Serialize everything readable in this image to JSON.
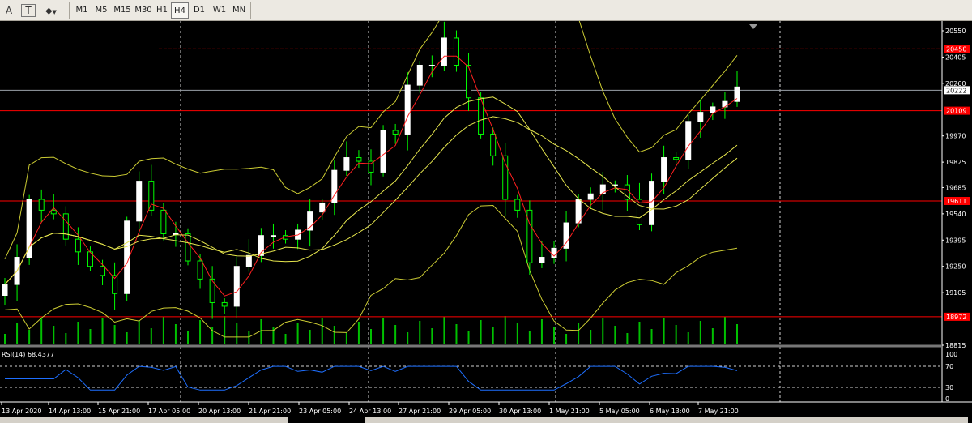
{
  "toolbar": {
    "icons": [
      "text-a-icon",
      "text-box-icon",
      "shapes-dropdown-icon"
    ],
    "icon_glyphs": [
      "A",
      "T",
      "⬥"
    ],
    "timeframes": [
      "M1",
      "M5",
      "M15",
      "M30",
      "H1",
      "H4",
      "D1",
      "W1",
      "MN"
    ],
    "active_timeframe": "H4"
  },
  "colors": {
    "background": "#000000",
    "bull": "#ffffff",
    "bear": "#00ff00",
    "wick": "#00ff00",
    "level": "#ff0000",
    "bands": "#cccc33",
    "ma_fast": "#ff2020",
    "ma_slow": "#e6e64d",
    "rsi": "#1e6fff",
    "volume": "#00c000"
  },
  "price_axis": {
    "labels": [
      "20550",
      "20405",
      "20260",
      "19970",
      "19825",
      "19685",
      "19540",
      "19395",
      "19250",
      "19105",
      "18815"
    ],
    "range": [
      18815,
      20550
    ]
  },
  "price_tags": [
    {
      "label": "20450",
      "value": 20450,
      "bg": "#ff0000",
      "fg": "#ffffff"
    },
    {
      "label": "20222",
      "value": 20222,
      "bg": "#ffffff",
      "fg": "#000000"
    },
    {
      "label": "20109",
      "value": 20109,
      "bg": "#ff0000",
      "fg": "#ffffff"
    },
    {
      "label": "19611",
      "value": 19611,
      "bg": "#ff0000",
      "fg": "#ffffff"
    },
    {
      "label": "18972",
      "value": 18972,
      "bg": "#ff0000",
      "fg": "#ffffff"
    }
  ],
  "levels": [
    20450,
    20109,
    19611,
    18972
  ],
  "current_price": 20222,
  "time_axis": [
    "13 Apr 2020",
    "14 Apr 13:00",
    "15 Apr 21:00",
    "17 Apr 05:00",
    "20 Apr 13:00",
    "21 Apr 21:00",
    "23 Apr 05:00",
    "24 Apr 13:00",
    "27 Apr 21:00",
    "29 Apr 05:00",
    "30 Apr 13:00",
    "1 May 21:00",
    "5 May 05:00",
    "6 May 13:00",
    "7 May 21:00"
  ],
  "rsi": {
    "label": "RSI(14) 68.4377",
    "levels": [
      "100",
      "70",
      "30",
      "0"
    ],
    "value": 68.4377
  },
  "chart_data": {
    "type": "candlestick",
    "symbol_timeframe": "H4",
    "ylim": [
      18815,
      20550
    ],
    "closes": [
      19150,
      19300,
      19620,
      19560,
      19540,
      19400,
      19330,
      19250,
      19200,
      19100,
      19500,
      19720,
      19560,
      19430,
      19430,
      19280,
      19180,
      19050,
      19030,
      19250,
      19310,
      19420,
      19420,
      19400,
      19450,
      19550,
      19600,
      19780,
      19850,
      19830,
      19770,
      20000,
      19980,
      20250,
      20360,
      20360,
      20510,
      20360,
      20180,
      19980,
      19860,
      19620,
      19560,
      19270,
      19300,
      19350,
      19490,
      19620,
      19650,
      19700,
      19700,
      19620,
      19480,
      19720,
      19850,
      19840,
      20050,
      20100,
      20130,
      20160,
      20240
    ]
  }
}
